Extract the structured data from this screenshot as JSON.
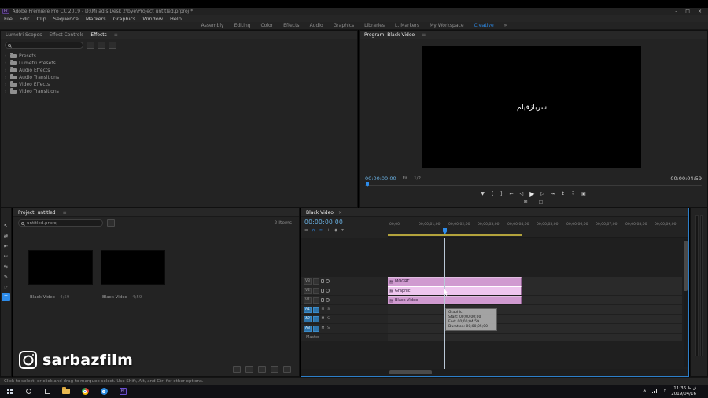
{
  "colors": {
    "accent": "#2d8ceb",
    "timecode_blue": "#6cb5e8",
    "graphic_clip": "#d09ad0",
    "graphic_clip_selected": "#eec6ee",
    "render_bar": "#b3a33c"
  },
  "icons": {
    "hamburger": "≡",
    "chevron": "›",
    "close": "×"
  },
  "app": {
    "title": "Adobe Premiere Pro CC 2019 - D:\\Milad's Desk 2\\bye\\Project untitled.prproj *",
    "app_badge": "Pr",
    "window_controls": {
      "minimize": "–",
      "maximize": "□",
      "close": "×"
    }
  },
  "menubar": {
    "items": [
      "File",
      "Edit",
      "Clip",
      "Sequence",
      "Markers",
      "Graphics",
      "Window",
      "Help"
    ]
  },
  "workspaces": {
    "items": [
      "Assembly",
      "Editing",
      "Color",
      "Effects",
      "Audio",
      "Graphics",
      "Libraries",
      "L. Markers",
      "My Workspace",
      "Creative"
    ],
    "overflow": "»"
  },
  "effects_panel": {
    "tabs": [
      "Lumetri Scopes",
      "Effect Controls",
      "Effects"
    ],
    "items": [
      "Presets",
      "Lumetri Presets",
      "Audio Effects",
      "Audio Transitions",
      "Video Effects",
      "Video Transitions"
    ]
  },
  "program": {
    "tab": "Program: Black Video",
    "overlay_text": "سربازفیلم",
    "current_time": "00:00:00:00",
    "fit_label": "Fit",
    "resolution": "1/2",
    "duration": "00:00:04:59",
    "transport": [
      "▼",
      "{",
      "}",
      "⇤",
      "◁",
      "▶",
      "▷",
      "⇥",
      "↥",
      "↧",
      "▣"
    ],
    "secondary": [
      "⊞",
      "□"
    ]
  },
  "tools": {
    "items": [
      "↖",
      "⇄",
      "⇤",
      "✂",
      "⇆",
      "✎",
      "☞",
      "T"
    ]
  },
  "project": {
    "tab": "Project: untitled",
    "search_value": "untitled.prproj",
    "items_count": "2 Items",
    "clips": [
      {
        "name": "Black Video",
        "duration": "4;59"
      },
      {
        "name": "Black Video",
        "duration": "4;59"
      }
    ]
  },
  "timeline": {
    "tab": "Black Video",
    "timecode": "00:00:00:00",
    "toolbar": [
      "≡",
      "∩",
      "∞",
      "+",
      "◆",
      "▾"
    ],
    "ruler": [
      "00;00",
      "00;00;01;00",
      "00;00;02;00",
      "00;00;03;00",
      "00;00;04;00",
      "00;00;05;00",
      "00;00;06;00",
      "00;00;07;00",
      "00;00;08;00",
      "00;00;09;00"
    ],
    "video_tracks": [
      "V3",
      "V2",
      "V1"
    ],
    "audio_tracks": [
      "A1",
      "A2",
      "A3"
    ],
    "master_label": "Master",
    "mute_label": "M",
    "solo_label": "S",
    "fx_badge": "fx",
    "clips": [
      {
        "name": "MOGRT"
      },
      {
        "name": "Graphic"
      },
      {
        "name": "Black Video"
      }
    ],
    "tooltip": {
      "lines": [
        "Graphic",
        "Start: 00;00;00;00",
        "End: 00;00;04;59",
        "Duration: 00;00;05;00"
      ]
    }
  },
  "status": {
    "hint": "Click to select, or click and drag to marquee select. Use Shift, Alt, and Ctrl for other options."
  },
  "watermark": {
    "handle": "sarbazfilm"
  },
  "taskbar": {
    "edge_label": "e",
    "premiere_badge": "Pr",
    "tray_chevron": "∧",
    "volume_icon": "♪",
    "clock_time": "11:36 ق.ظ",
    "clock_date": "2019/04/16"
  }
}
